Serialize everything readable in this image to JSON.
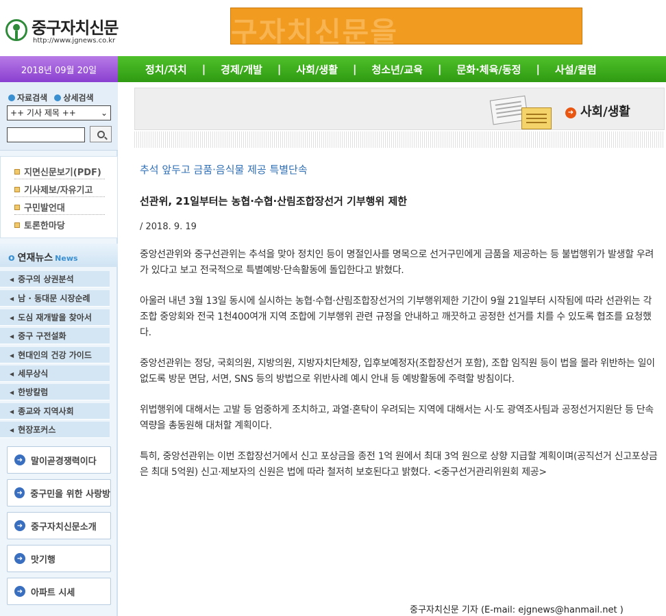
{
  "header": {
    "logo_title": "중구자치신문",
    "logo_url": "http://www.jgnews.co.kr",
    "banner_text": "구자치신문을"
  },
  "topbar": {
    "date": "2018년 09월 20일",
    "nav": [
      "정치/자치",
      "경제/개발",
      "사회/생활",
      "청소년/교육",
      "문화·체육/동정",
      "사설/컬럼"
    ],
    "separator": "|"
  },
  "sidebar": {
    "search_links": [
      "자료검색",
      "상세검색"
    ],
    "search_select": "++ 기사 제목 ++",
    "search_input_value": "",
    "quick_links": [
      "지면신문보기(PDF)",
      "기사제보/자유기고",
      "구민발언대",
      "토론한마당"
    ],
    "series_title": "연재뉴스",
    "series_news": "News",
    "series_items": [
      "중구의 상권분석",
      "남 · 동대문 시장순례",
      "도심 재개발을 찾아서",
      "중구 구전설화",
      "현대인의 건강 가이드",
      "세무상식",
      "한방칼럼",
      "종교와 지역사회",
      "현장포커스"
    ],
    "menu_buttons": [
      "말이곧경쟁력이다",
      "중구민을 위한 사랑방",
      "중구자치신문소개",
      "맛기행",
      "아파트 시세"
    ]
  },
  "section": {
    "label": "사회/생활"
  },
  "article": {
    "kicker": "추석 앞두고 금품·음식물 제공 특별단속",
    "headline": "선관위, 21일부터는 농협·수협·산림조합장선거 기부행위 제한",
    "date": "/ 2018. 9. 19",
    "paragraphs": [
      "중앙선관위와 중구선관위는 추석을 맞아 정치인 등이 명절인사를 명목으로 선거구민에게 금품을 제공하는 등 불법행위가 발생할 우려가 있다고 보고 전국적으로 특별예방·단속활동에 돌입한다고 밝혔다.",
      "아울러 내년 3월 13일 동시에 실시하는 농협·수협·산림조합장선거의 기부행위제한 기간이 9월 21일부터 시작됨에 따라 선관위는 각 조합 중앙회와 전국 1천400여개 지역 조합에 기부행위 관련 규정을 안내하고 깨끗하고 공정한 선거를 치를 수 있도록 협조를 요청했다.",
      "중앙선관위는 정당, 국회의원, 지방의원, 지방자치단체장, 입후보예정자(조합장선거 포함), 조합 임직원 등이 법을 몰라 위반하는 일이 없도록 방문 면담, 서면, SNS 등의 방법으로 위반사례 예시 안내 등 예방활동에 주력할 방침이다.",
      "위법행위에 대해서는 고발 등 엄중하게 조치하고, 과열·혼탁이 우려되는 지역에 대해서는 시·도 광역조사팀과 공정선거지원단 등 단속역량을 총동원해 대처할 계획이다.",
      "특히, 중앙선관위는 이번 조합장선거에서 신고 포상금을 종전 1억 원에서 최대 3억 원으로 상향 지급할 계획이며(공직선거 신고포상금은 최대 5억원) 신고·제보자의 신원은 법에 따라 철저히 보호된다고 밝혔다. <중구선거관리위원회 제공>"
    ],
    "byline": "중구자치신문 기자 (E-mail: ejgnews@hanmail.net )"
  }
}
